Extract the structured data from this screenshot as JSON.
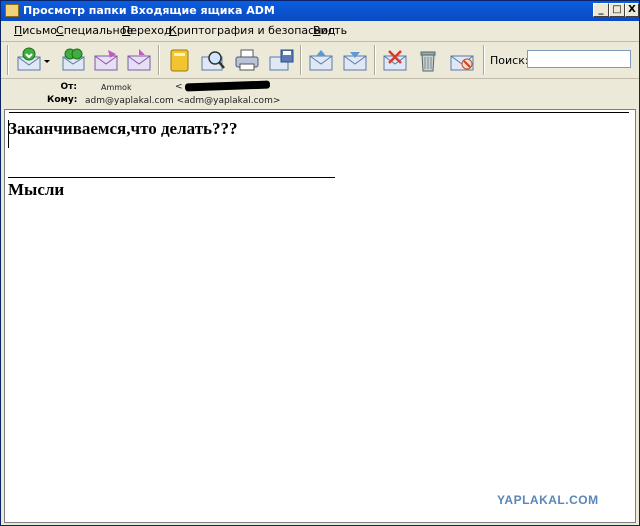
{
  "window": {
    "title": "Просмотр папки Входящие ящика ADM",
    "controls": {
      "minimize": "_",
      "maximize": "□",
      "close": "X"
    }
  },
  "menu": [
    {
      "acc": "П",
      "rest": "исьмо"
    },
    {
      "acc": "С",
      "rest": "пециальное"
    },
    {
      "acc": "П",
      "rest": "ереход"
    },
    {
      "acc": "К",
      "rest": "риптография и безопасность"
    },
    {
      "acc": "В",
      "rest": "ид"
    }
  ],
  "toolbar": {
    "buttons": [
      "get-mail-icon",
      "reply-all-icon",
      "send-icon",
      "forward-icon",
      "address-book-icon",
      "find-icon",
      "print-icon",
      "save-icon",
      "move-up-icon",
      "move-down-icon",
      "delete-mail-icon",
      "trash-icon",
      "junk-icon"
    ],
    "search_label": "Поиск:",
    "search_value": ""
  },
  "header": {
    "from_label": "От:",
    "from_name": "Ammok",
    "from_addr_prefix": "<",
    "to_label": "Кому:",
    "to_value": "adm@yaplakal.com <adm@yaplakal.com>"
  },
  "message": {
    "line1": "Заканчиваемся,что делать???",
    "line2": "Мысли"
  },
  "watermark": "YAPLAKAL.COM"
}
